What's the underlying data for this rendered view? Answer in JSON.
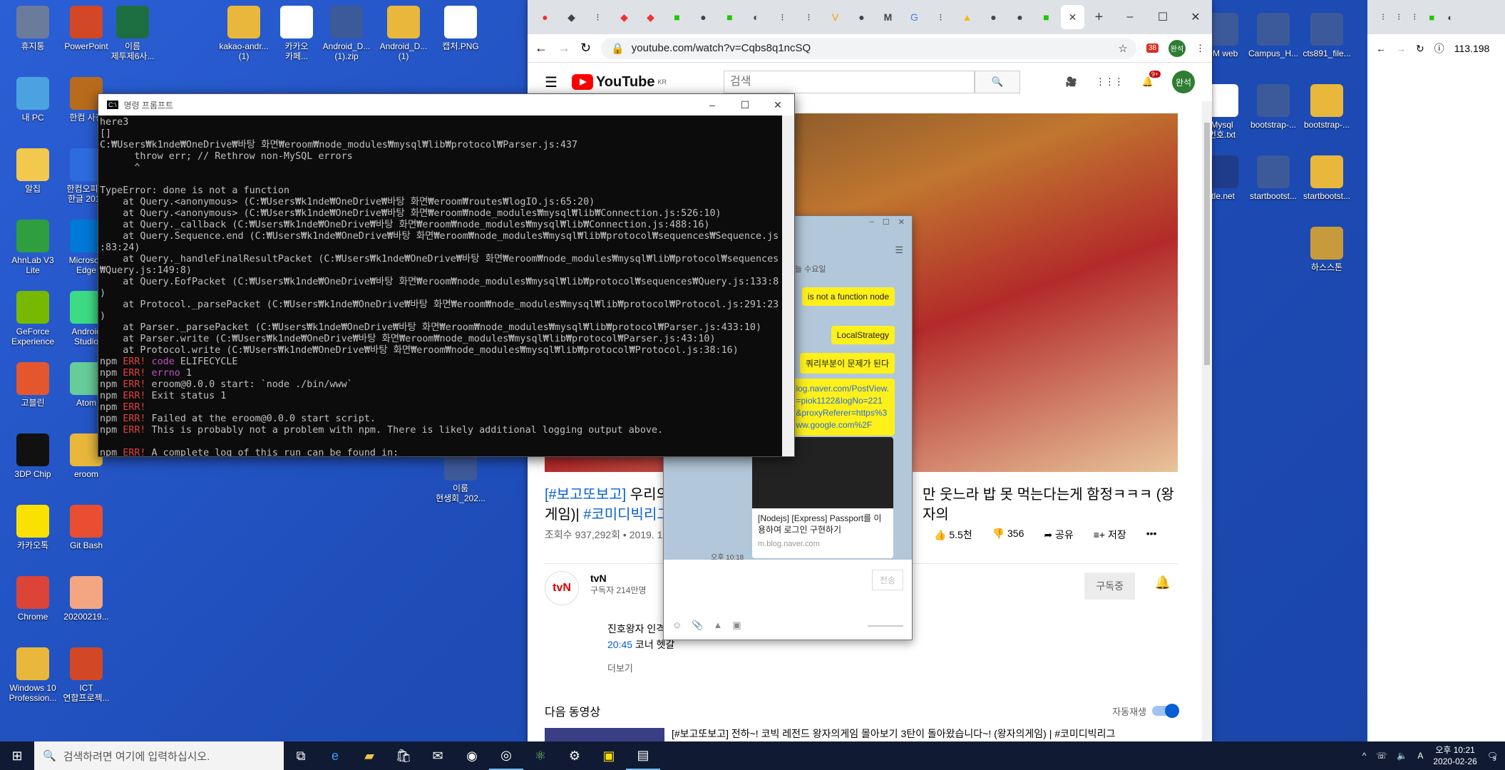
{
  "desktop_icons": [
    {
      "label": "휴지통",
      "color": "#6a7b9c"
    },
    {
      "label": "PowerPoint",
      "color": "#d24726"
    },
    {
      "label": "이름\n제투제6사...",
      "color": "#1d6f42"
    },
    {
      "label": "kakao-andr...\n(1)",
      "color": "#e8b73c"
    },
    {
      "label": "카카오\n카페...",
      "color": "#ffffff"
    },
    {
      "label": "Android_D...\n(1).zip",
      "color": "#3c5a99"
    },
    {
      "label": "Android_D...\n(1)",
      "color": "#e8b73c"
    },
    {
      "label": "캡처.PNG",
      "color": "#ffffff"
    },
    {
      "label": "내 PC",
      "color": "#4aa3df"
    },
    {
      "label": "한컴 사전",
      "color": "#b86b1c"
    },
    {
      "label": "알집",
      "color": "#f2c94c"
    },
    {
      "label": "한컴오피스\n한글 2018",
      "color": "#2d6cdf"
    },
    {
      "label": "AhnLab V3\nLite",
      "color": "#2e9e3e"
    },
    {
      "label": "Microsoft\nEdge",
      "color": "#0078d7"
    },
    {
      "label": "GeForce\nExperience",
      "color": "#76b900"
    },
    {
      "label": "Android\nStudio",
      "color": "#3ddc84"
    },
    {
      "label": "고블린",
      "color": "#e4572e"
    },
    {
      "label": "Atom",
      "color": "#66cc99"
    },
    {
      "label": "3DP Chip",
      "color": "#111111"
    },
    {
      "label": "eroom",
      "color": "#e8b73c"
    },
    {
      "label": "카카오톡",
      "color": "#fae100"
    },
    {
      "label": "Git Bash",
      "color": "#e94e31"
    },
    {
      "label": "Chrome",
      "color": "#db4437"
    },
    {
      "label": "20200219...",
      "color": "#f4a582"
    },
    {
      "label": "Windows 10\nProfession...",
      "color": "#e8b73c"
    },
    {
      "label": "ICT\n연합프로젝...",
      "color": "#d24726"
    },
    {
      "label": "이룸\n현생회_202...",
      "color": "#3c5a99"
    },
    {
      "label": "Mysql\n번호.txt",
      "color": "#ffffff"
    },
    {
      "label": "bootstrap-...",
      "color": "#3c5a99"
    },
    {
      "label": "bootstrap-...",
      "color": "#e8b73c"
    },
    {
      "label": "ttle.net",
      "color": "#1f3c8a"
    },
    {
      "label": "startbootst...",
      "color": "#3c5a99"
    },
    {
      "label": "startbootst...",
      "color": "#e8b73c"
    },
    {
      "label": "하스스톤",
      "color": "#c79b3b"
    },
    {
      "label": "OM web",
      "color": "#3c5a99"
    },
    {
      "label": "Campus_H...",
      "color": "#3c5a99"
    },
    {
      "label": "cts891_file...",
      "color": "#3c5a99"
    }
  ],
  "cmd": {
    "title": "명령 프롬프트",
    "lines": [
      "here3",
      "[]",
      "C:₩Users₩k1nde₩OneDrive₩바탕 화면₩eroom₩node_modules₩mysql₩lib₩protocol₩Parser.js:437",
      "      throw err; // Rethrow non-MySQL errors",
      "      ^",
      "",
      "TypeError: done is not a function",
      "    at Query.<anonymous> (C:₩Users₩k1nde₩OneDrive₩바탕 화면₩eroom₩routes₩logIO.js:65:20)",
      "    at Query.<anonymous> (C:₩Users₩k1nde₩OneDrive₩바탕 화면₩eroom₩node_modules₩mysql₩lib₩Connection.js:526:10)",
      "    at Query._callback (C:₩Users₩k1nde₩OneDrive₩바탕 화면₩eroom₩node_modules₩mysql₩lib₩Connection.js:488:16)",
      "    at Query.Sequence.end (C:₩Users₩k1nde₩OneDrive₩바탕 화면₩eroom₩node_modules₩mysql₩lib₩protocol₩sequences₩Sequence.js",
      ":83:24)",
      "    at Query._handleFinalResultPacket (C:₩Users₩k1nde₩OneDrive₩바탕 화면₩eroom₩node_modules₩mysql₩lib₩protocol₩sequences",
      "₩Query.js:149:8)",
      "    at Query.EofPacket (C:₩Users₩k1nde₩OneDrive₩바탕 화면₩eroom₩node_modules₩mysql₩lib₩protocol₩sequences₩Query.js:133:8",
      ")",
      "    at Protocol._parsePacket (C:₩Users₩k1nde₩OneDrive₩바탕 화면₩eroom₩node_modules₩mysql₩lib₩protocol₩Protocol.js:291:23",
      ")",
      "    at Parser._parsePacket (C:₩Users₩k1nde₩OneDrive₩바탕 화면₩eroom₩node_modules₩mysql₩lib₩protocol₩Parser.js:433:10)",
      "    at Parser.write (C:₩Users₩k1nde₩OneDrive₩바탕 화면₩eroom₩node_modules₩mysql₩lib₩protocol₩Parser.js:43:10)",
      "    at Protocol.write (C:₩Users₩k1nde₩OneDrive₩바탕 화면₩eroom₩node_modules₩mysql₩lib₩protocol₩Protocol.js:38:16)"
    ],
    "npm_lines": [
      {
        "tag": "ERR!",
        "key": "code",
        "text": " ELIFECYCLE"
      },
      {
        "tag": "ERR!",
        "key": "errno",
        "text": " 1"
      },
      {
        "tag": "ERR!",
        "key": "",
        "text": " eroom@0.0.0 start: `node ./bin/www`"
      },
      {
        "tag": "ERR!",
        "key": "",
        "text": " Exit status 1"
      },
      {
        "tag": "ERR!",
        "key": "",
        "text": ""
      },
      {
        "tag": "ERR!",
        "key": "",
        "text": " Failed at the eroom@0.0.0 start script."
      },
      {
        "tag": "ERR!",
        "key": "",
        "text": " This is probably not a problem with npm. There is likely additional logging output above."
      },
      {
        "tag": "",
        "key": "",
        "text": ""
      },
      {
        "tag": "ERR!",
        "key": "",
        "text": " A complete log of this run can be found in:"
      }
    ]
  },
  "browser": {
    "url": "youtube.com/watch?v=Cqbs8q1ncSQ",
    "profile": "완석",
    "ext_badge": "38",
    "yt_logo": "YouTube",
    "yt_region": "KR",
    "search_placeholder": "검색",
    "notif_count": "9+",
    "title_prefix": "[#보고또보고]",
    "title_mid": " 우리의",
    "title_right": "만 웃느라 밥 못 먹는다는게 함정ㅋㅋㅋ (왕자의",
    "title_line2_a": "게임)|",
    "title_line2_b": "#코미디빅리그",
    "views": "조회수 937,292회 • 2019. 1",
    "likes": "5.5천",
    "dislikes": "356",
    "share": "공유",
    "save": "저장",
    "channel_name": "tvN",
    "subscribers": "구독자 214만명",
    "subscribe_label": "구독중",
    "desc_line1": "진호왕자 인격 몇",
    "desc_time": "20:45",
    "desc_line2": " 코너 헷갈",
    "more": "더보기",
    "next_header": "다음 동영상",
    "autoplay": "자동재생",
    "next_title": "[#보고또보고] 전하~! 코빅 레전드 왕자의게임 몰아보기 3탄이 돌아왔습니다~! (왕자의게임) | #코미디빅리그"
  },
  "kakao": {
    "bubbles": [
      "is not a function node",
      "LocalStrategy",
      "쿼리부분이 문제가 된다"
    ],
    "link_lines": [
      "log.naver.com/PostView.",
      "=piok1122&logNo=221",
      "&proxyReferer=https%3",
      "ww.google.com%2F"
    ],
    "card_title": "[Nodejs] [Express] Passport를 이용하여 로그인 구현하기",
    "card_site": "m.blog.naver.com",
    "time": "오후 10:18",
    "send": "전송",
    "header_label": "늘 수요일"
  },
  "browser2": {
    "url": "113.198"
  },
  "taskbar": {
    "search_placeholder": "검색하려면 여기에 입력하십시오.",
    "time": "오후 10:21",
    "date": "2020-02-26",
    "ime": "A",
    "notif": "9"
  }
}
